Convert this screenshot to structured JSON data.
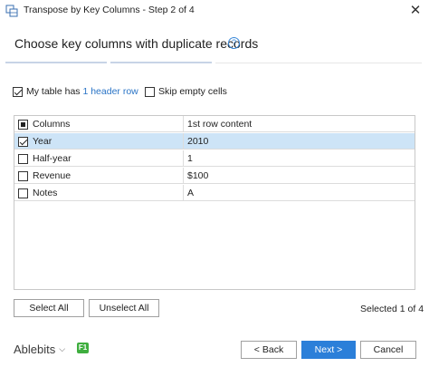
{
  "window": {
    "title": "Transpose by Key Columns - Step 2 of 4",
    "close_glyph": "✕"
  },
  "header": {
    "heading": "Choose key columns with duplicate records",
    "help_glyph": "?"
  },
  "options": {
    "header_prefix": "My table has ",
    "header_link": "1 header row",
    "header_checked": true,
    "skip_label": "Skip empty cells",
    "skip_checked": false
  },
  "grid": {
    "columns": [
      "Columns",
      "1st row content"
    ],
    "rows": [
      {
        "name": "Year",
        "value": "2010",
        "checked": true
      },
      {
        "name": "Half-year",
        "value": "1",
        "checked": false
      },
      {
        "name": "Revenue",
        "value": "$100",
        "checked": false
      },
      {
        "name": "Notes",
        "value": "A",
        "checked": false
      }
    ]
  },
  "actions": {
    "select_all": "Select All",
    "unselect_all": "Unselect All",
    "selected_count": "Selected 1 of 4"
  },
  "footer": {
    "brand": "Ablebits",
    "brand_chevron": "⌵",
    "f1": "F1",
    "back": "< Back",
    "next": "Next >",
    "cancel": "Cancel"
  },
  "colors": {
    "accent": "#2b7fd9",
    "selected_row": "#cde4f7",
    "link": "#2a74c6",
    "f1_badge": "#3fae3f"
  }
}
